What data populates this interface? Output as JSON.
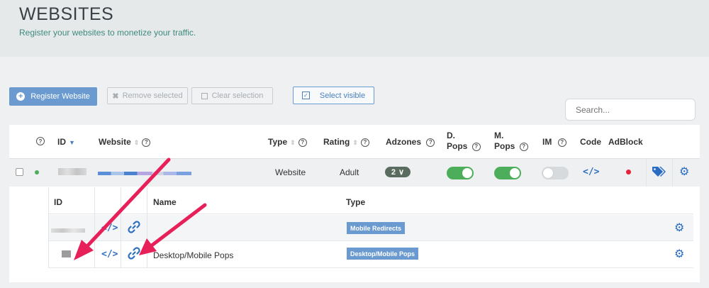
{
  "header": {
    "title": "WEBSITES",
    "subtitle": "Register your websites to monetize your traffic."
  },
  "toolbar": {
    "register_label": "Register Website",
    "remove_label": "Remove selected",
    "clear_label": "Clear selection",
    "select_visible_label": "Select visible",
    "search_placeholder": "Search..."
  },
  "table": {
    "columns": {
      "id": "ID",
      "website": "Website",
      "type": "Type",
      "rating": "Rating",
      "adzones": "Adzones",
      "d_pops_line1": "D.",
      "d_pops_line2": "Pops",
      "m_pops_line1": "M.",
      "m_pops_line2": "Pops",
      "im": "IM",
      "code": "Code",
      "adblock": "AdBlock"
    },
    "row": {
      "type": "Website",
      "rating": "Adult",
      "adzones_count": "2",
      "adzones_chevron": "∨",
      "d_pops_enabled": true,
      "m_pops_enabled": true,
      "im_enabled": false,
      "code_symbol": "</>",
      "status_color": "#4cae5a",
      "adblock_color": "#e8203a"
    },
    "subtable": {
      "columns": {
        "id": "ID",
        "name": "Name",
        "type": "Type"
      },
      "rows": [
        {
          "name": "",
          "type": "Mobile Redirects",
          "code_symbol": "</>"
        },
        {
          "name": "Desktop/Mobile Pops",
          "type": "Desktop/Mobile Pops",
          "code_symbol": "</>"
        }
      ]
    }
  },
  "colors": {
    "accent": "#6a9ad0",
    "link": "#2f6fc0",
    "toggle_on": "#4cae5a",
    "arrow": "#e8205a"
  }
}
